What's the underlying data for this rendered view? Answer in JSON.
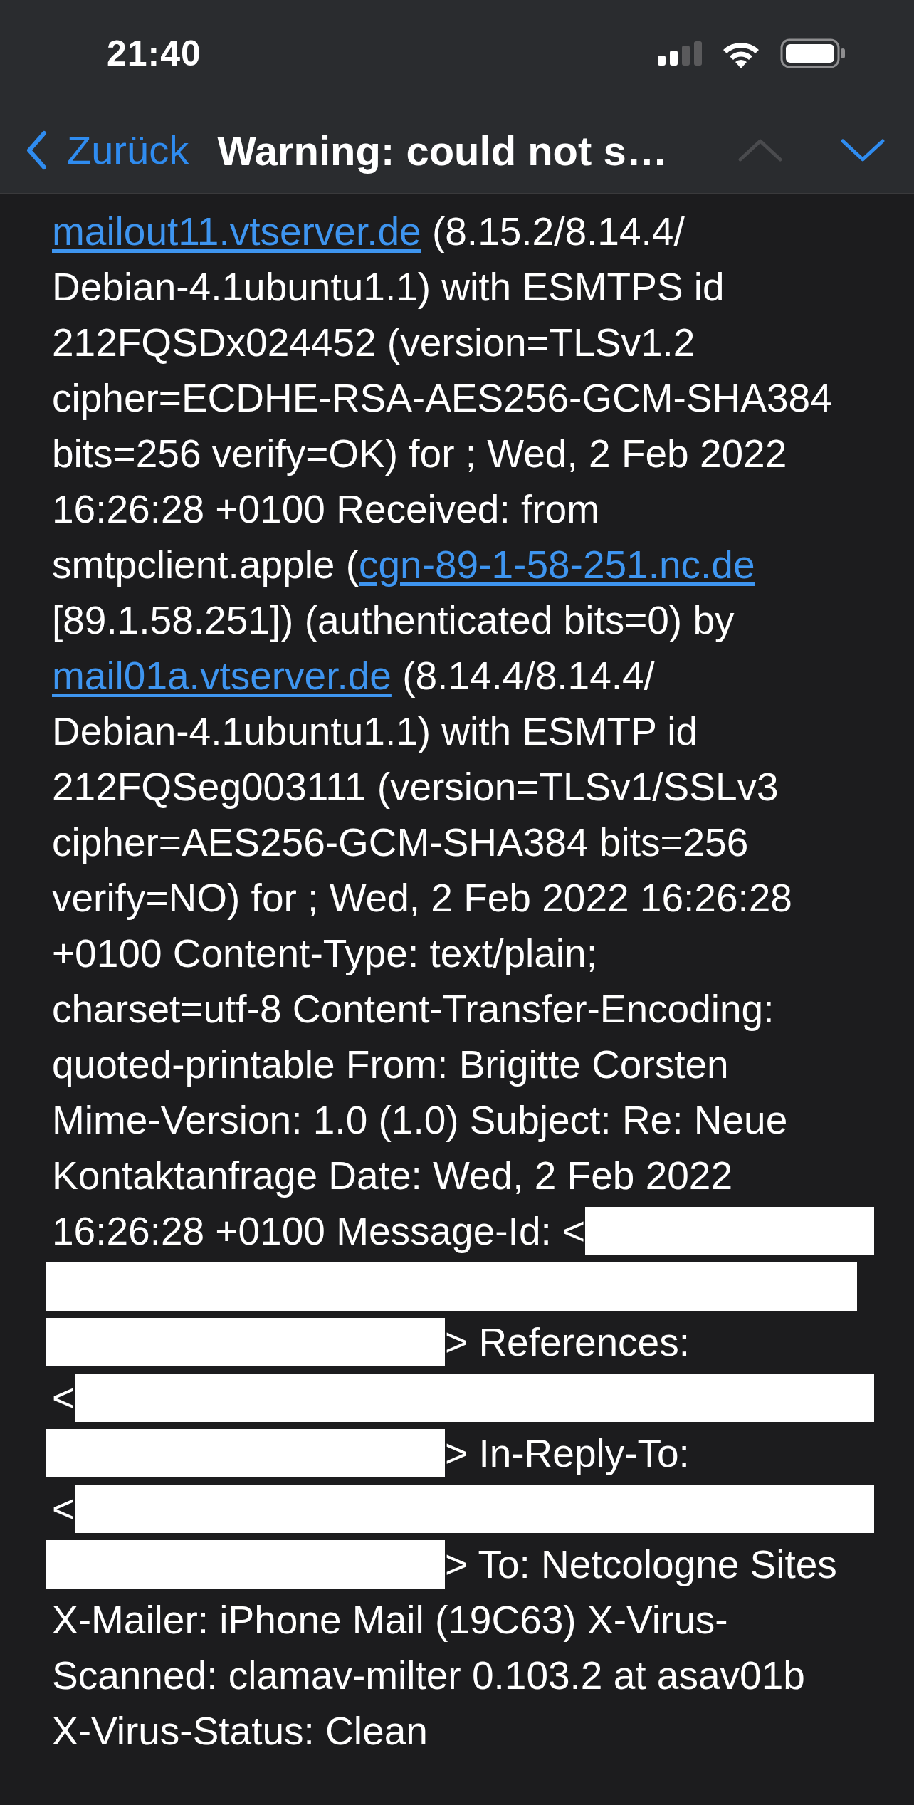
{
  "status_bar": {
    "time": "21:40"
  },
  "nav": {
    "back": "Zurück",
    "title": "Warning: could not s…",
    "buttons": [
      {
        "kind": "up",
        "disabled": true
      },
      {
        "kind": "down",
        "disabled": false
      }
    ]
  },
  "body_lines": [
    {
      "segments": [
        {
          "kind": "link",
          "text": "mailout11.vtserver.de"
        },
        {
          "kind": "text",
          "text": " (8.15.2/8.14.4/"
        }
      ]
    },
    {
      "segments": [
        {
          "kind": "text",
          "text": "Debian-4.1ubuntu1.1) with ESMTPS id"
        }
      ]
    },
    {
      "segments": [
        {
          "kind": "text",
          "text": "212FQSDx024452 (version=TLSv1.2"
        }
      ]
    },
    {
      "segments": [
        {
          "kind": "text",
          "text": "cipher=ECDHE-RSA-AES256-GCM-SHA384"
        }
      ]
    },
    {
      "segments": [
        {
          "kind": "text",
          "text": "bits=256 verify=OK) for ; Wed, 2 Feb 2022"
        }
      ]
    },
    {
      "segments": [
        {
          "kind": "text",
          "text": "16:26:28 +0100 Received: from"
        }
      ]
    },
    {
      "segments": [
        {
          "kind": "text",
          "text": "smtpclient.apple ("
        },
        {
          "kind": "link",
          "text": "cgn-89-1-58-251.nc.de"
        }
      ]
    },
    {
      "segments": [
        {
          "kind": "text",
          "text": "[89.1.58.251]) (authenticated bits=0) by"
        }
      ]
    },
    {
      "segments": [
        {
          "kind": "link",
          "text": "mail01a.vtserver.de"
        },
        {
          "kind": "text",
          "text": " (8.14.4/8.14.4/"
        }
      ]
    },
    {
      "segments": [
        {
          "kind": "text",
          "text": "Debian-4.1ubuntu1.1) with ESMTP id"
        }
      ]
    },
    {
      "segments": [
        {
          "kind": "text",
          "text": "212FQSeg003111 (version=TLSv1/SSLv3"
        }
      ]
    },
    {
      "segments": [
        {
          "kind": "text",
          "text": "cipher=AES256-GCM-SHA384 bits=256"
        }
      ]
    },
    {
      "segments": [
        {
          "kind": "text",
          "text": "verify=NO) for ; Wed, 2 Feb 2022 16:26:28"
        }
      ]
    },
    {
      "segments": [
        {
          "kind": "text",
          "text": "+0100 Content-Type: text/plain;"
        }
      ]
    },
    {
      "segments": [
        {
          "kind": "text",
          "text": "charset=utf-8 Content-Transfer-Encoding:"
        }
      ]
    },
    {
      "segments": [
        {
          "kind": "text",
          "text": "quoted-printable From: Brigitte Corsten"
        }
      ]
    },
    {
      "segments": [
        {
          "kind": "text",
          "text": "Mime-Version: 1.0 (1.0) Subject: Re: Neue"
        }
      ]
    },
    {
      "segments": [
        {
          "kind": "text",
          "text": "Kontaktanfrage Date: Wed, 2 Feb 2022"
        }
      ]
    },
    {
      "segments": [
        {
          "kind": "text",
          "text": "16:26:28 +0100 Message-Id: <"
        },
        {
          "kind": "redacted"
        }
      ]
    },
    {
      "segments": [
        {
          "kind": "redacted"
        }
      ]
    },
    {
      "segments": [
        {
          "kind": "redacted"
        },
        {
          "kind": "text",
          "text": "> References:"
        }
      ]
    },
    {
      "segments": [
        {
          "kind": "text",
          "text": "<"
        },
        {
          "kind": "redacted"
        }
      ]
    },
    {
      "segments": [
        {
          "kind": "redacted"
        },
        {
          "kind": "text",
          "text": "> In-Reply-To:"
        }
      ]
    },
    {
      "segments": [
        {
          "kind": "text",
          "text": "<"
        },
        {
          "kind": "redacted"
        }
      ]
    },
    {
      "segments": [
        {
          "kind": "redacted"
        },
        {
          "kind": "text",
          "text": "> To: Netcologne Sites"
        }
      ]
    },
    {
      "segments": [
        {
          "kind": "text",
          "text": "X-Mailer: iPhone Mail (19C63) X-Virus-"
        }
      ]
    },
    {
      "segments": [
        {
          "kind": "text",
          "text": "Scanned: clamav-milter 0.103.2 at asav01b"
        }
      ]
    },
    {
      "segments": [
        {
          "kind": "text",
          "text": "X-Virus-Status: Clean"
        }
      ]
    }
  ]
}
